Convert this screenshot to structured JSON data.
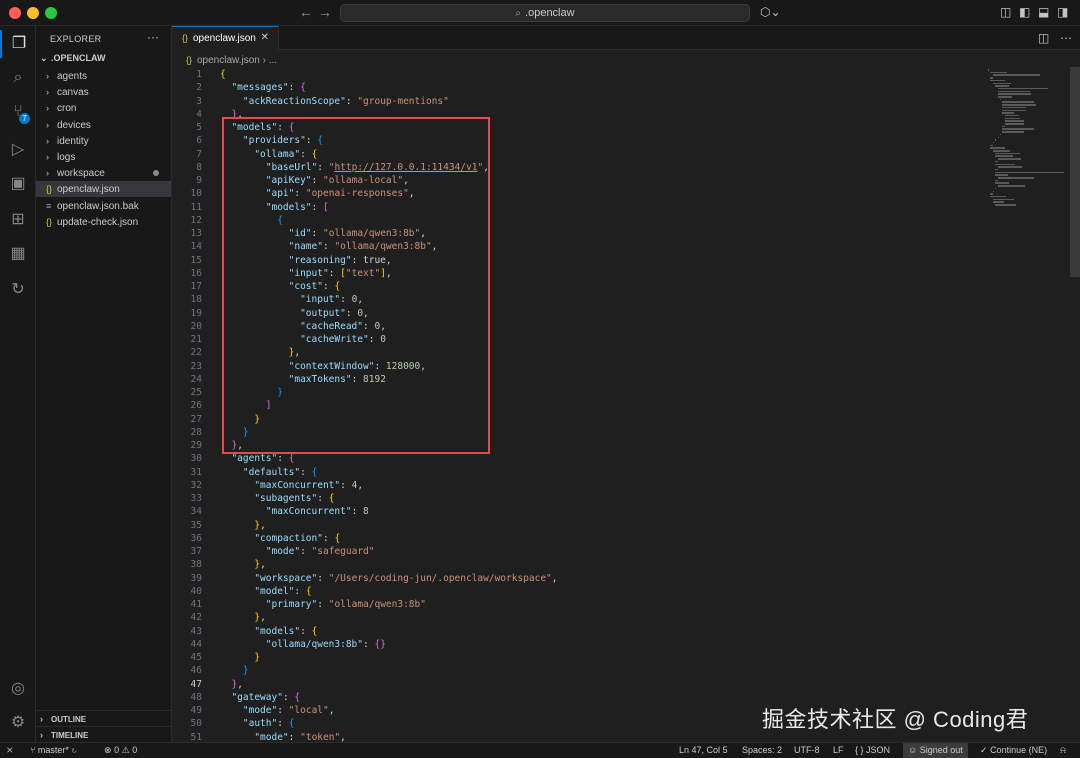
{
  "titlebar": {
    "search": ".openclaw",
    "nav_back": "←",
    "nav_forward": "→"
  },
  "sidebar": {
    "title": "EXPLORER",
    "more": "···",
    "root": ".OPENCLAW",
    "folders": [
      "agents",
      "canvas",
      "cron",
      "devices",
      "identity",
      "logs",
      "workspace"
    ],
    "files": [
      "openclaw.json",
      "openclaw.json.bak",
      "update-check.json"
    ],
    "sections": [
      "OUTLINE",
      "TIMELINE"
    ]
  },
  "activity": {
    "scm_badge": "7"
  },
  "editor": {
    "tab_label": "openclaw.json",
    "breadcrumb_file": "openclaw.json",
    "breadcrumb_more": "...",
    "current_line": 47
  },
  "code_lines": [
    "{",
    "  \"messages\": {",
    "    \"ackReactionScope\": \"group-mentions\"",
    "  },",
    "  \"models\": {",
    "    \"providers\": {",
    "      \"ollama\": {",
    "        \"baseUrl\": \"http://127.0.0.1:11434/v1\",",
    "        \"apiKey\": \"ollama-local\",",
    "        \"api\": \"openai-responses\",",
    "        \"models\": [",
    "          {",
    "            \"id\": \"ollama/qwen3:8b\",",
    "            \"name\": \"ollama/qwen3:8b\",",
    "            \"reasoning\": true,",
    "            \"input\": [\"text\"],",
    "            \"cost\": {",
    "              \"input\": 0,",
    "              \"output\": 0,",
    "              \"cacheRead\": 0,",
    "              \"cacheWrite\": 0",
    "            },",
    "            \"contextWindow\": 128000,",
    "            \"maxTokens\": 8192",
    "          }",
    "        ]",
    "      }",
    "    }",
    "  },",
    "  \"agents\": {",
    "    \"defaults\": {",
    "      \"maxConcurrent\": 4,",
    "      \"subagents\": {",
    "        \"maxConcurrent\": 8",
    "      },",
    "      \"compaction\": {",
    "        \"mode\": \"safeguard\"",
    "      },",
    "      \"workspace\": \"/Users/coding-jun/.openclaw/workspace\",",
    "      \"model\": {",
    "        \"primary\": \"ollama/qwen3:8b\"",
    "      },",
    "      \"models\": {",
    "        \"ollama/qwen3:8b\": {}",
    "      }",
    "    }",
    "  },",
    "  \"gateway\": {",
    "    \"mode\": \"local\",",
    "    \"auth\": {",
    "      \"mode\": \"token\","
  ],
  "statusbar": {
    "branch": "master*",
    "errors": "0",
    "warnings": "0",
    "position": "Ln 47, Col 5",
    "spaces": "Spaces: 2",
    "encoding": "UTF-8",
    "eol": "LF",
    "language": "JSON",
    "signed": "Signed out",
    "continue": "Continue (NE)"
  },
  "watermark": {
    "text": "掘金技术社区 @ Coding君"
  },
  "colors": {
    "highlight_box": "#e5484d",
    "accent": "#0078d4",
    "json_key": "#9cdcfe",
    "json_string": "#ce9178",
    "json_number": "#b5cea8",
    "json_bool": "#569cd6"
  }
}
